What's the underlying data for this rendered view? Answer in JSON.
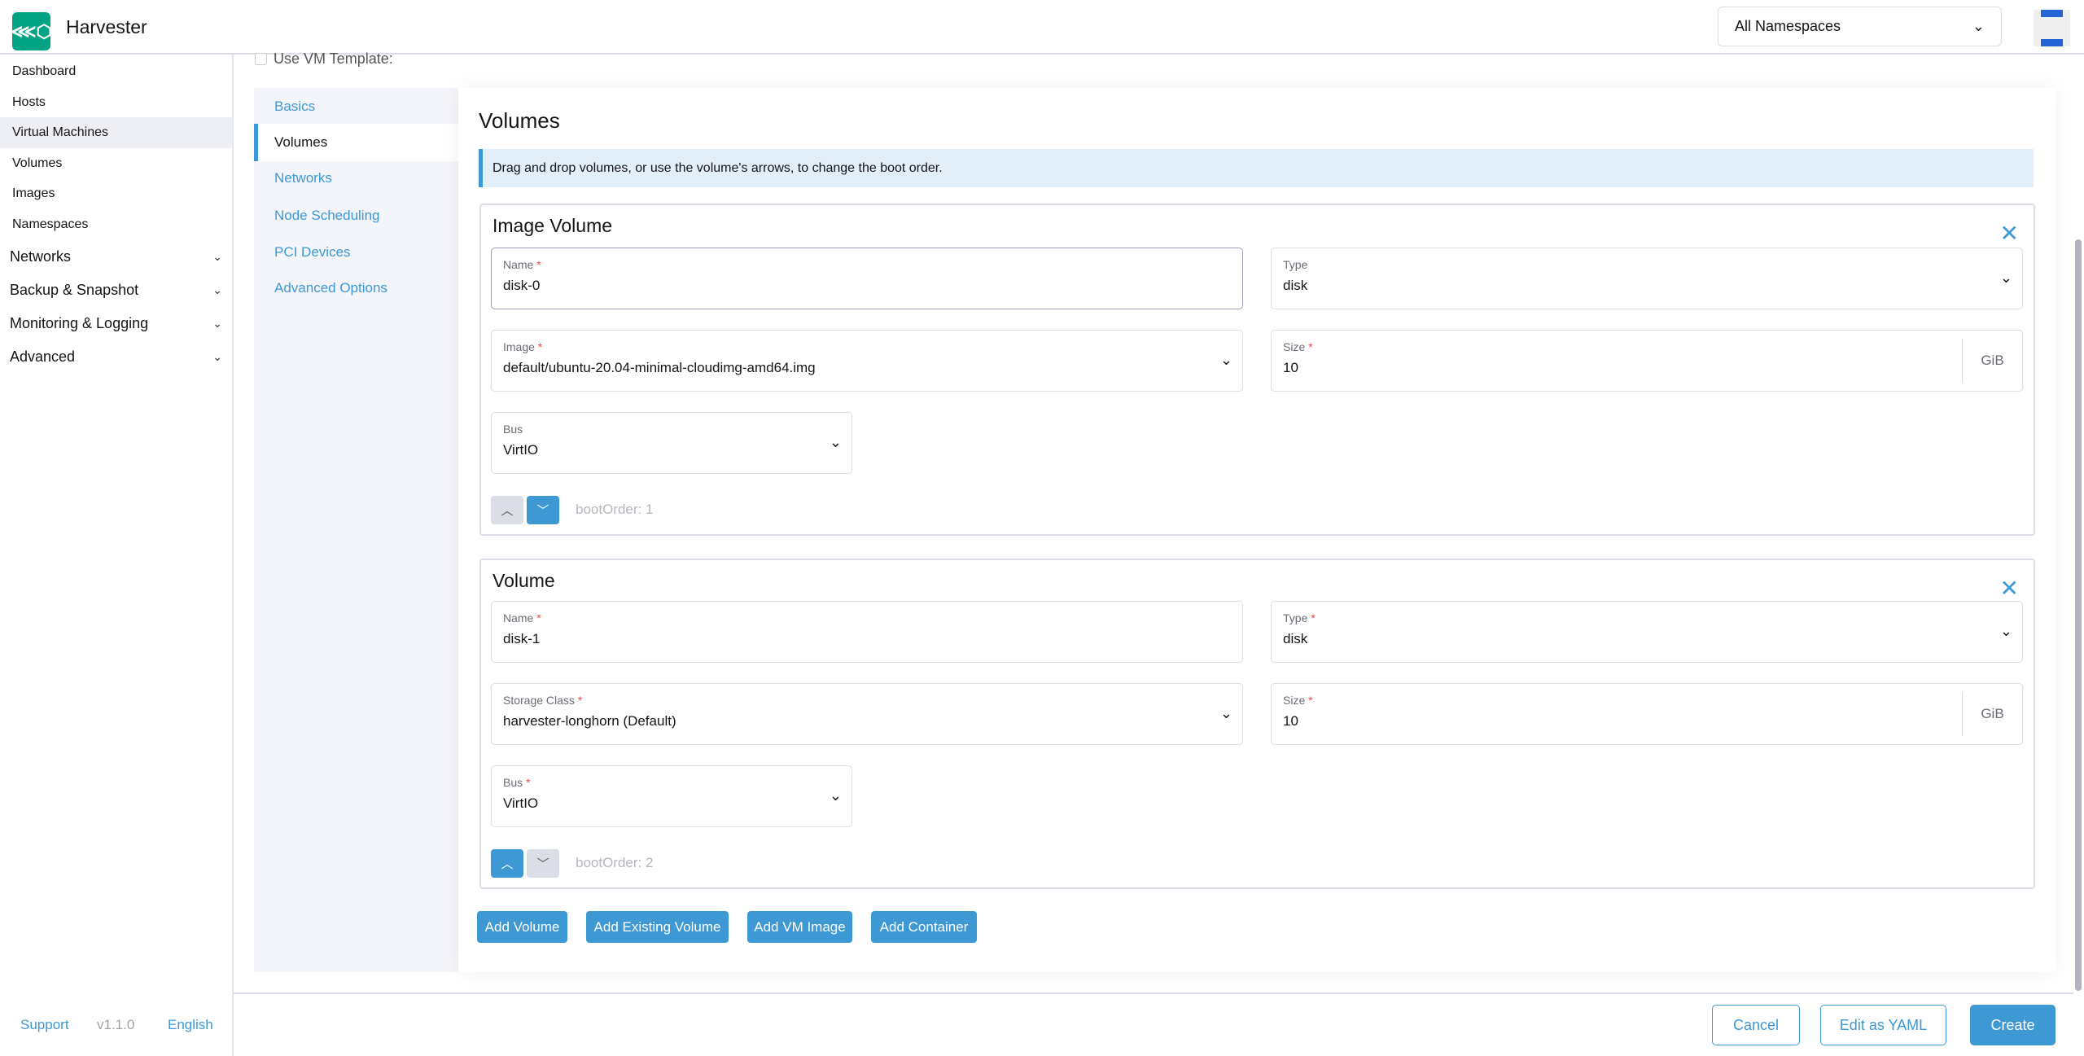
{
  "header": {
    "app_title": "Harvester",
    "namespace_select": "All Namespaces"
  },
  "sidebar": {
    "items": [
      {
        "label": "Dashboard"
      },
      {
        "label": "Hosts"
      },
      {
        "label": "Virtual Machines",
        "active": true
      },
      {
        "label": "Volumes"
      },
      {
        "label": "Images"
      },
      {
        "label": "Namespaces"
      }
    ],
    "groups": [
      {
        "label": "Networks"
      },
      {
        "label": "Backup & Snapshot"
      },
      {
        "label": "Monitoring & Logging"
      },
      {
        "label": "Advanced"
      }
    ],
    "footer": {
      "support": "Support",
      "version": "v1.1.0",
      "language": "English"
    }
  },
  "form": {
    "use_vm_template": "Use VM Template:",
    "tabs": [
      {
        "label": "Basics"
      },
      {
        "label": "Volumes",
        "active": true
      },
      {
        "label": "Networks"
      },
      {
        "label": "Node Scheduling"
      },
      {
        "label": "PCI Devices"
      },
      {
        "label": "Advanced Options"
      }
    ],
    "heading": "Volumes",
    "banner": "Drag and drop volumes, or use the volume's arrows, to change the boot order.",
    "volumes": [
      {
        "title": "Image Volume",
        "name_label": "Name",
        "name": "disk-0",
        "type_label": "Type",
        "type": "disk",
        "source_label": "Image",
        "source": "default/ubuntu-20.04-minimal-cloudimg-amd64.img",
        "size_label": "Size",
        "size": "10",
        "unit": "GiB",
        "bus_label": "Bus",
        "bus": "VirtIO",
        "boot_order": "bootOrder: 1"
      },
      {
        "title": "Volume",
        "name_label": "Name",
        "name": "disk-1",
        "type_label": "Type",
        "type": "disk",
        "source_label": "Storage Class",
        "source": "harvester-longhorn (Default)",
        "size_label": "Size",
        "size": "10",
        "unit": "GiB",
        "bus_label": "Bus",
        "bus": "VirtIO",
        "boot_order": "bootOrder: 2"
      }
    ],
    "add_buttons": [
      "Add Volume",
      "Add Existing Volume",
      "Add VM Image",
      "Add Container"
    ]
  },
  "footer": {
    "cancel": "Cancel",
    "edit_yaml": "Edit as YAML",
    "create": "Create"
  },
  "colors": {
    "accent": "#3d98d3",
    "brand": "#00a483",
    "required": "#f64747"
  }
}
